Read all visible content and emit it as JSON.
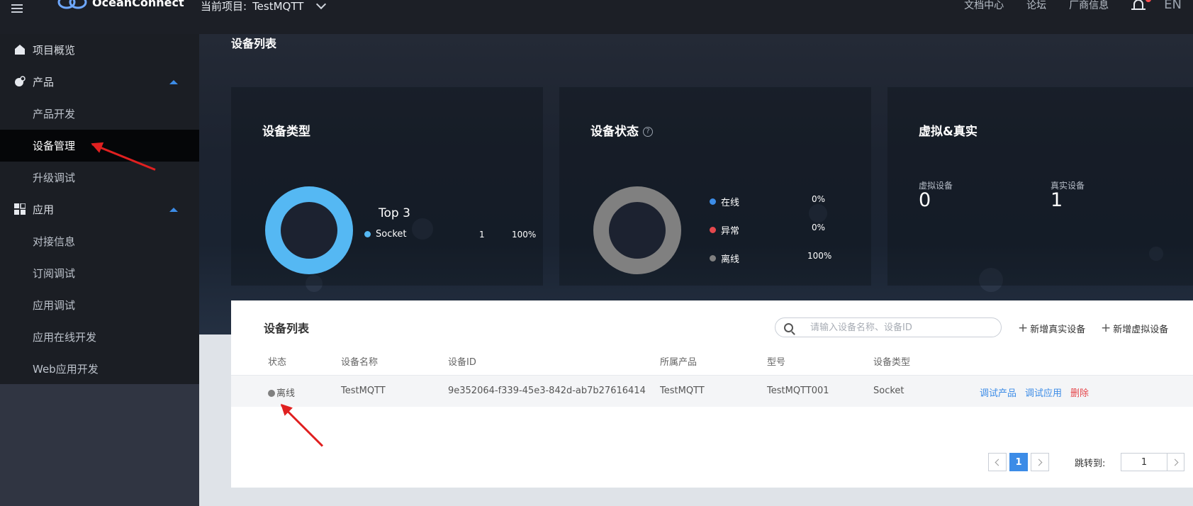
{
  "header": {
    "brand": "OceanConnect",
    "project_label": "当前项目:",
    "project_name": "TestMQTT",
    "links": [
      "文档中心",
      "论坛",
      "厂商信息"
    ],
    "lang": "EN"
  },
  "sidebar": {
    "items": [
      {
        "label": "项目概览",
        "type": "top",
        "icon": "home-icon"
      },
      {
        "label": "产品",
        "type": "top",
        "icon": "product-icon",
        "expanded": true
      },
      {
        "label": "产品开发",
        "type": "sub"
      },
      {
        "label": "设备管理",
        "type": "sub",
        "active": true
      },
      {
        "label": "升级调试",
        "type": "sub"
      },
      {
        "label": "应用",
        "type": "top",
        "icon": "apps-grid-icon",
        "expanded": true
      },
      {
        "label": "对接信息",
        "type": "sub"
      },
      {
        "label": "订阅调试",
        "type": "sub"
      },
      {
        "label": "应用调试",
        "type": "sub"
      },
      {
        "label": "应用在线开发",
        "type": "sub"
      },
      {
        "label": "Web应用开发",
        "type": "sub"
      }
    ]
  },
  "hero": {
    "title": "设备列表",
    "device_type": {
      "title": "设备类型",
      "subtitle": "Top 3",
      "rows": [
        {
          "name": "Socket",
          "count": "1",
          "percent": "100%",
          "color": "#55b8f3"
        }
      ]
    },
    "device_status": {
      "title": "设备状态",
      "rows": [
        {
          "name": "在线",
          "percent": "0%",
          "color": "#3c8ce7"
        },
        {
          "name": "异常",
          "percent": "0%",
          "color": "#e5484d"
        },
        {
          "name": "离线",
          "percent": "100%",
          "color": "#808080"
        }
      ]
    },
    "virtual_real": {
      "title": "虚拟&真实",
      "virtual_label": "虚拟设备",
      "virtual_count": "0",
      "real_label": "真实设备",
      "real_count": "1"
    }
  },
  "device_list": {
    "title": "设备列表",
    "search_placeholder": "请输入设备名称、设备ID",
    "add_real": "新增真实设备",
    "add_virtual": "新增虚拟设备",
    "columns": [
      "状态",
      "设备名称",
      "设备ID",
      "所属产品",
      "型号",
      "设备类型"
    ],
    "rows": [
      {
        "status": "离线",
        "name": "TestMQTT",
        "device_id": "9e352064-f339-45e3-842d-ab7b27616414",
        "product": "TestMQTT",
        "model": "TestMQTT001",
        "type": "Socket",
        "actions": [
          "调试产品",
          "调试应用",
          "删除"
        ]
      }
    ],
    "pagination": {
      "current_page": "1",
      "jump_label": "跳转到:",
      "jump_value": "1"
    }
  }
}
